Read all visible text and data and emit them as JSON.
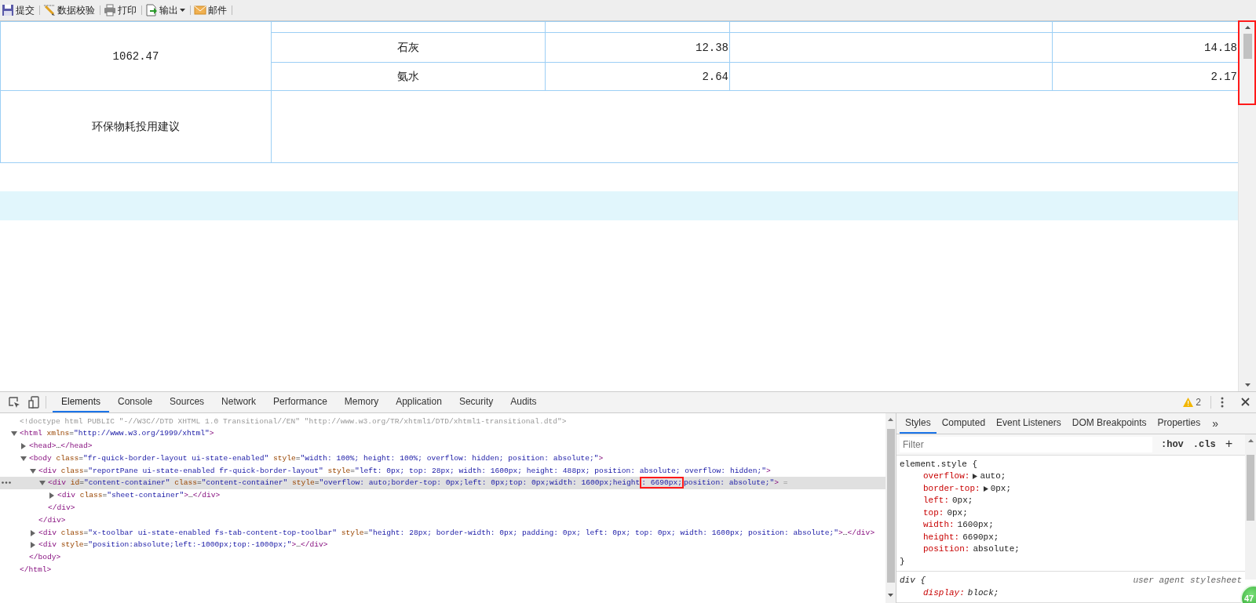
{
  "toolbar": {
    "buttons": [
      {
        "kind": "save",
        "label": "提交"
      },
      {
        "kind": "validate",
        "label": "数据校验"
      },
      {
        "kind": "print",
        "label": "打印"
      },
      {
        "kind": "export",
        "label": "输出",
        "has_menu": true
      },
      {
        "kind": "mail",
        "label": "邮件"
      }
    ]
  },
  "report": {
    "group_value": "1062.47",
    "rows": [
      {
        "column_2": "石灰",
        "column_3": "12.38",
        "column_5": "14.18"
      },
      {
        "column_2": "氨水",
        "column_3": "2.64",
        "column_5": "2.17"
      }
    ],
    "note_label": "环保物耗投用建议"
  },
  "devtools": {
    "tabs": [
      {
        "label": "Elements",
        "selected": true
      },
      {
        "label": "Console",
        "selected": false
      },
      {
        "label": "Sources",
        "selected": false
      },
      {
        "label": "Network",
        "selected": false
      },
      {
        "label": "Performance",
        "selected": false
      },
      {
        "label": "Memory",
        "selected": false
      },
      {
        "label": "Application",
        "selected": false
      },
      {
        "label": "Security",
        "selected": false
      },
      {
        "label": "Audits",
        "selected": false
      }
    ],
    "warning_count": "2",
    "dom": [
      {
        "selected": false,
        "tokens": [
          {
            "kind": "doctype",
            "text": "<!doctype html PUBLIC \"-//W3C//DTD XHTML 1.0 Transitional//EN\" \"http://www.w3.org/TR/xhtml1/DTD/xhtml1-transitional.dtd\">"
          }
        ]
      },
      {
        "selected": false,
        "tokens": [
          {
            "kind": "tag",
            "text": "<html"
          },
          {
            "kind": "attr",
            "text": " xmlns"
          },
          {
            "kind": "text",
            "text": "="
          },
          {
            "kind": "value",
            "text": "\"http://www.w3.org/1999/xhtml\""
          },
          {
            "kind": "tag",
            "text": ">"
          }
        ],
        "close": [
          {
            "kind": "tag",
            "text": "</html>"
          }
        ],
        "children": [
          {
            "selected": false,
            "expanded": false,
            "tokens": [
              {
                "kind": "tag",
                "text": "<head>"
              },
              {
                "kind": "text",
                "text": "…"
              },
              {
                "kind": "tag",
                "text": "</head>"
              }
            ]
          },
          {
            "selected": false,
            "expanded": true,
            "tokens": [
              {
                "kind": "tag",
                "text": "<body"
              },
              {
                "kind": "attr",
                "text": " class"
              },
              {
                "kind": "text",
                "text": "="
              },
              {
                "kind": "value",
                "text": "\"fr-quick-border-layout ui-state-enabled\""
              },
              {
                "kind": "attr",
                "text": " style"
              },
              {
                "kind": "text",
                "text": "="
              },
              {
                "kind": "value",
                "text": "\"width: 100%; height: 100%; overflow: hidden; position: absolute;\""
              },
              {
                "kind": "tag",
                "text": ">"
              }
            ],
            "close": [
              {
                "kind": "tag",
                "text": "</body>"
              }
            ],
            "children": [
              {
                "selected": false,
                "expanded": true,
                "tokens": [
                  {
                    "kind": "tag",
                    "text": "<div"
                  },
                  {
                    "kind": "attr",
                    "text": " class"
                  },
                  {
                    "kind": "text",
                    "text": "="
                  },
                  {
                    "kind": "value",
                    "text": "\"reportPane ui-state-enabled fr-quick-border-layout\""
                  },
                  {
                    "kind": "attr",
                    "text": " style"
                  },
                  {
                    "kind": "text",
                    "text": "="
                  },
                  {
                    "kind": "value",
                    "text": "\"left: 0px; top: 28px; width: 1600px; height: 488px; position: absolute; overflow: hidden;\""
                  },
                  {
                    "kind": "tag",
                    "text": ">"
                  }
                ],
                "close": [
                  {
                    "kind": "tag",
                    "text": "</div>"
                  }
                ],
                "children": [
                  {
                    "selected": true,
                    "expanded": true,
                    "tokens": [
                      {
                        "kind": "tag",
                        "text": "<div"
                      },
                      {
                        "kind": "attr",
                        "text": " id"
                      },
                      {
                        "kind": "text",
                        "text": "="
                      },
                      {
                        "kind": "value",
                        "text": "\"content-container\""
                      },
                      {
                        "kind": "attr",
                        "text": " class"
                      },
                      {
                        "kind": "text",
                        "text": "="
                      },
                      {
                        "kind": "value",
                        "text": "\"content-container\""
                      },
                      {
                        "kind": "attr",
                        "text": " style"
                      },
                      {
                        "kind": "text",
                        "text": "="
                      },
                      {
                        "kind": "value",
                        "text": "\"overflow: auto;border-top: 0px;left: 0px;top: 0px;width: 1600px;height"
                      },
                      {
                        "kind": "value",
                        "text": ": 6690px;",
                        "boxed": true
                      },
                      {
                        "kind": "value",
                        "text": "position: absolute;\""
                      },
                      {
                        "kind": "tag",
                        "text": ">"
                      },
                      {
                        "kind": "dim",
                        "text": " ="
                      }
                    ],
                    "close": [
                      {
                        "kind": "tag",
                        "text": "</div>"
                      }
                    ],
                    "children": [
                      {
                        "selected": false,
                        "expanded": false,
                        "tokens": [
                          {
                            "kind": "tag",
                            "text": "<div"
                          },
                          {
                            "kind": "attr",
                            "text": " class"
                          },
                          {
                            "kind": "text",
                            "text": "="
                          },
                          {
                            "kind": "value",
                            "text": "\"sheet-container\""
                          },
                          {
                            "kind": "tag",
                            "text": ">"
                          },
                          {
                            "kind": "text",
                            "text": "…"
                          },
                          {
                            "kind": "tag",
                            "text": "</div>"
                          }
                        ]
                      }
                    ]
                  }
                ]
              },
              {
                "selected": false,
                "expanded": false,
                "tokens": [
                  {
                    "kind": "tag",
                    "text": "<div"
                  },
                  {
                    "kind": "attr",
                    "text": " class"
                  },
                  {
                    "kind": "text",
                    "text": "="
                  },
                  {
                    "kind": "value",
                    "text": "\"x-toolbar ui-state-enabled fs-tab-content-top-toolbar\""
                  },
                  {
                    "kind": "attr",
                    "text": " style"
                  },
                  {
                    "kind": "text",
                    "text": "="
                  },
                  {
                    "kind": "value",
                    "text": "\"height: 28px; border-width: 0px; padding: 0px; left: 0px; top: 0px; width: 1600px; position: absolute;\""
                  },
                  {
                    "kind": "tag",
                    "text": ">"
                  },
                  {
                    "kind": "text",
                    "text": "…"
                  },
                  {
                    "kind": "tag",
                    "text": "</div>"
                  }
                ]
              },
              {
                "selected": false,
                "expanded": false,
                "tokens": [
                  {
                    "kind": "tag",
                    "text": "<div"
                  },
                  {
                    "kind": "attr",
                    "text": " style"
                  },
                  {
                    "kind": "text",
                    "text": "="
                  },
                  {
                    "kind": "value",
                    "text": "\"position:absolute;left:-1000px;top:-1000px;\""
                  },
                  {
                    "kind": "tag",
                    "text": ">"
                  },
                  {
                    "kind": "text",
                    "text": "…"
                  },
                  {
                    "kind": "tag",
                    "text": "</div>"
                  }
                ]
              }
            ]
          }
        ]
      }
    ],
    "style_tabs": [
      {
        "label": "Styles",
        "selected": true
      },
      {
        "label": "Computed",
        "selected": false
      },
      {
        "label": "Event Listeners",
        "selected": false
      },
      {
        "label": "DOM Breakpoints",
        "selected": false
      },
      {
        "label": "Properties",
        "selected": false
      }
    ],
    "more_tabs": "»",
    "filter": {
      "placeholder": "Filter"
    },
    "filter_buttons": [
      ":hov",
      ".cls",
      "+"
    ],
    "rules": [
      {
        "kind": "inline",
        "selector": "element.style {",
        "close": "}",
        "declarations": [
          {
            "property": "overflow:",
            "value": "auto;",
            "expandable": true
          },
          {
            "property": "border-top:",
            "value": "0px;",
            "expandable": true
          },
          {
            "property": "left:",
            "value": "0px;",
            "expandable": false
          },
          {
            "property": "top:",
            "value": "0px;",
            "expandable": false
          },
          {
            "property": "width:",
            "value": "1600px;",
            "expandable": false
          },
          {
            "property": "height:",
            "value": "6690px;",
            "expandable": false
          },
          {
            "property": "position:",
            "value": "absolute;",
            "expandable": false
          }
        ]
      },
      {
        "kind": "user-agent",
        "selector": "div {",
        "source": "user agent stylesheet",
        "declarations": [
          {
            "property": "display:",
            "value": "block;",
            "expandable": false
          }
        ]
      }
    ]
  },
  "floating_badge": "47"
}
